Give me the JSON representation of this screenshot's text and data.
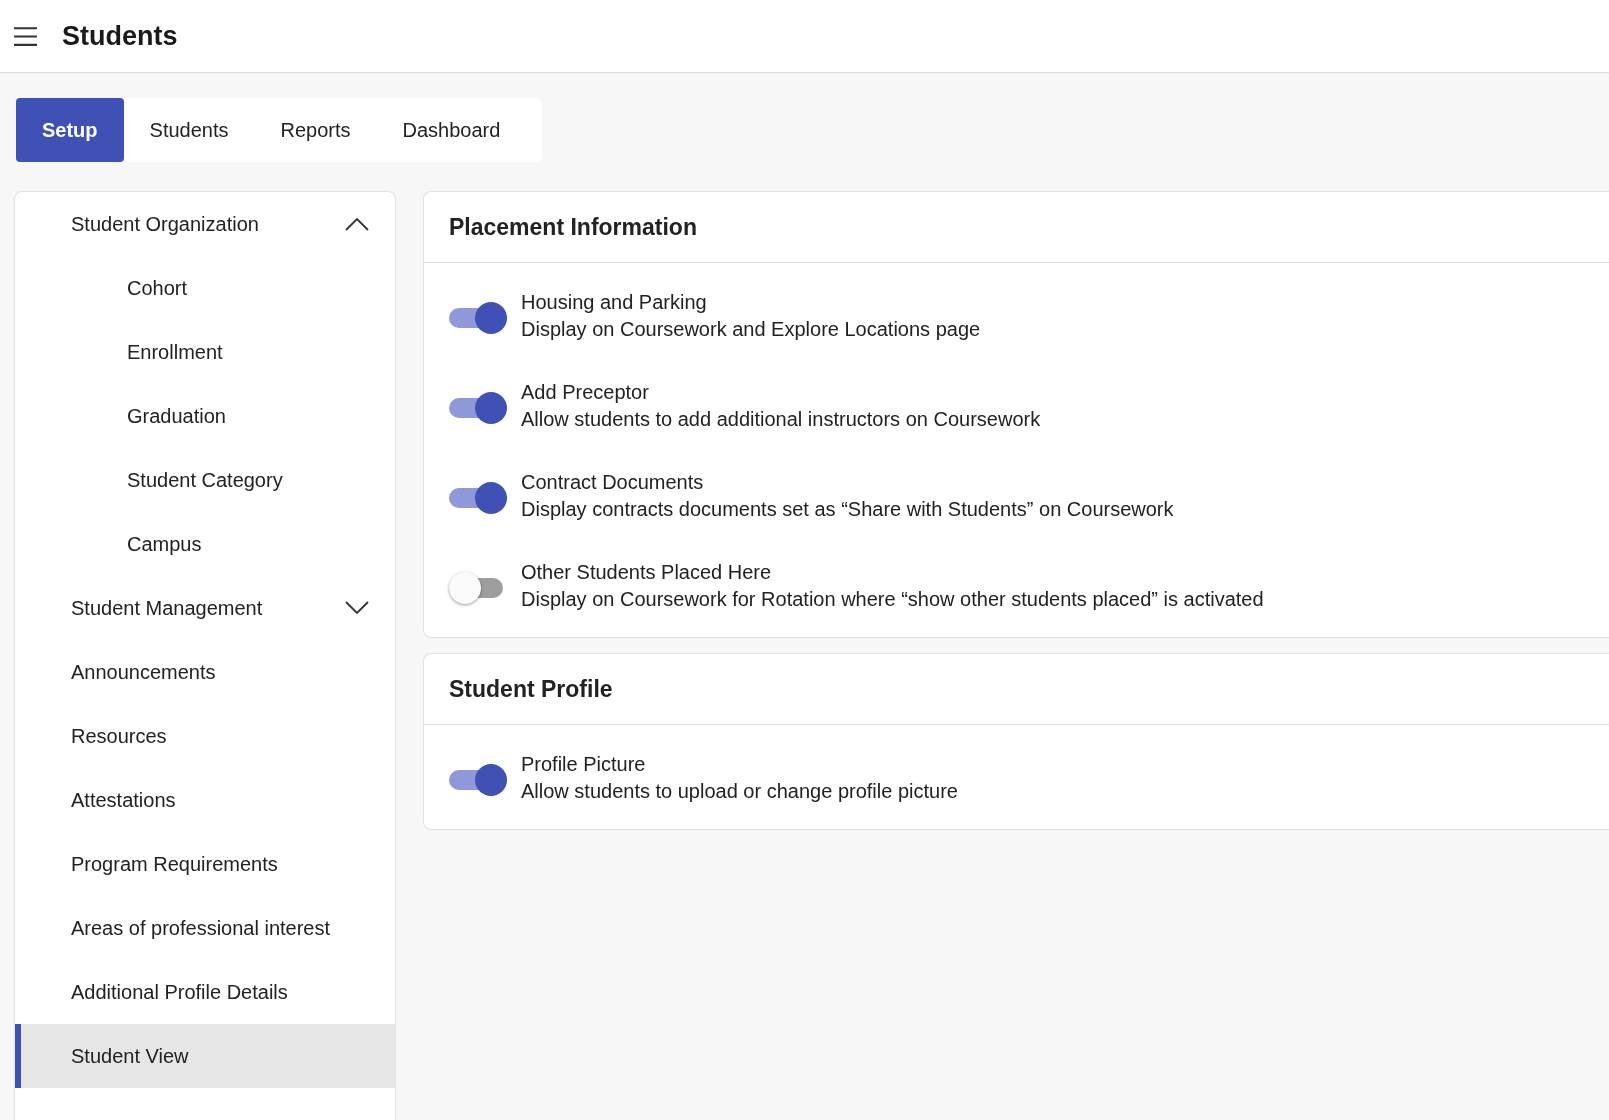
{
  "header": {
    "title": "Students"
  },
  "tabs": [
    {
      "label": "Setup",
      "selected": true
    },
    {
      "label": "Students",
      "selected": false
    },
    {
      "label": "Reports",
      "selected": false
    },
    {
      "label": "Dashboard",
      "selected": false
    }
  ],
  "sidebar": {
    "items": [
      {
        "label": "Student Organization",
        "kind": "group",
        "expanded": true,
        "selected": false,
        "children": [
          {
            "label": "Cohort",
            "selected": false
          },
          {
            "label": "Enrollment",
            "selected": false
          },
          {
            "label": "Graduation",
            "selected": false
          },
          {
            "label": "Student Category",
            "selected": false
          },
          {
            "label": "Campus",
            "selected": false
          }
        ]
      },
      {
        "label": "Student Management",
        "kind": "group",
        "expanded": false,
        "selected": false
      },
      {
        "label": "Announcements",
        "kind": "item",
        "selected": false
      },
      {
        "label": "Resources",
        "kind": "item",
        "selected": false
      },
      {
        "label": "Attestations",
        "kind": "item",
        "selected": false
      },
      {
        "label": "Program Requirements",
        "kind": "item",
        "selected": false
      },
      {
        "label": "Areas of professional interest",
        "kind": "item",
        "selected": false
      },
      {
        "label": "Additional Profile Details",
        "kind": "item",
        "selected": false
      },
      {
        "label": "Student View",
        "kind": "item",
        "selected": true
      }
    ]
  },
  "sections": [
    {
      "title": "Placement Information",
      "settings": [
        {
          "title": "Housing and Parking",
          "description": "Display on Coursework and Explore Locations page",
          "on": true
        },
        {
          "title": "Add Preceptor",
          "description": "Allow students to add additional instructors on Coursework",
          "on": true
        },
        {
          "title": "Contract Documents",
          "description": "Display contracts documents set as “Share with Students” on Coursework",
          "on": true
        },
        {
          "title": "Other Students Placed Here",
          "description": "Display on Coursework for Rotation where “show other students placed” is activated",
          "on": false
        }
      ]
    },
    {
      "title": "Student Profile",
      "settings": [
        {
          "title": "Profile Picture",
          "description": "Allow students to upload or change profile picture",
          "on": true
        }
      ]
    }
  ]
}
